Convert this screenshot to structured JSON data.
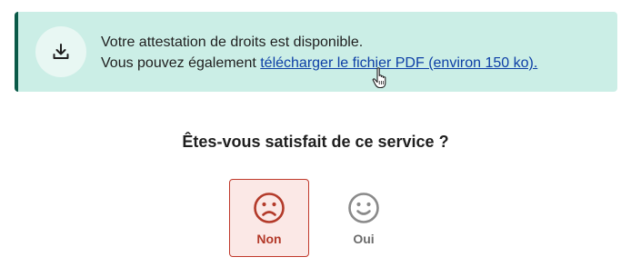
{
  "banner": {
    "line1": "Votre attestation de droits est disponible.",
    "line2_prefix": "Vous pouvez également ",
    "link_text": "télécharger le fichier PDF (environ 150 ko).",
    "icon": "download-icon",
    "accent_color": "#0a5a48",
    "background_color": "#cbeee6"
  },
  "feedback": {
    "question": "Êtes-vous satisfait de ce service ?",
    "options": [
      {
        "label": "Non",
        "icon": "sad-face-icon",
        "selected": true,
        "color": "#b33a2a"
      },
      {
        "label": "Oui",
        "icon": "happy-face-icon",
        "selected": false,
        "color": "#8a8a8a"
      }
    ]
  }
}
